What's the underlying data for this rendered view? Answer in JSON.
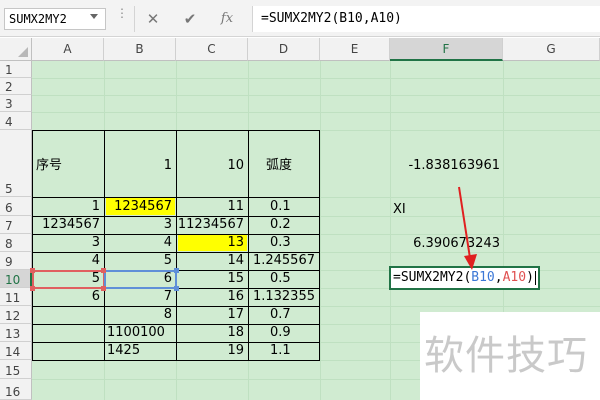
{
  "formula_bar": {
    "name_box": "SUMX2MY2",
    "cancel_icon": "✕",
    "enter_icon": "✔",
    "fx_label": "fx",
    "formula": "=SUMX2MY2(B10,A10)"
  },
  "columns": [
    "A",
    "B",
    "C",
    "D",
    "E",
    "F",
    "G"
  ],
  "selected_column": "F",
  "rows": [
    "1",
    "2",
    "3",
    "4",
    "5",
    "6",
    "7",
    "8",
    "9",
    "10",
    "11",
    "12",
    "13",
    "14",
    "15",
    "16"
  ],
  "selected_row": "10",
  "table": {
    "header": {
      "a": "序号",
      "b": "1",
      "c": "10",
      "d": "弧度"
    },
    "rows": [
      {
        "a": "1",
        "b": "1234567",
        "c": "11",
        "d": "0.1"
      },
      {
        "a": "1234567",
        "b": "3",
        "c": "11234567",
        "d": "0.2"
      },
      {
        "a": "3",
        "b": "4",
        "c": "13",
        "d": "0.3"
      },
      {
        "a": "4",
        "b": "5",
        "c": "14",
        "d": "1.245567"
      },
      {
        "a": "5",
        "b": "6",
        "c": "15",
        "d": "0.5"
      },
      {
        "a": "6",
        "b": "7",
        "c": "16",
        "d": "1.132355"
      },
      {
        "a": "",
        "b": "8",
        "c": "17",
        "d": "0.7"
      },
      {
        "a": "",
        "b": "1100100",
        "c": "18",
        "d": "0.9"
      },
      {
        "a": "",
        "b": "1425",
        "c": "19",
        "d": "1.1"
      }
    ]
  },
  "f_column": {
    "f5": "-1.838163961",
    "f6": "XI",
    "f8": "6.390673243"
  },
  "edit_cell": {
    "prefix": "=SUMX2MY2(",
    "ref1": "B10",
    "comma": ",",
    "ref2": "A10",
    "suffix": ")"
  },
  "watermark": "软件技巧",
  "colors": {
    "grid_green": "#d0ebd1",
    "highlight_yellow": "#ffff00",
    "ref_blue": "#3b77d6",
    "ref_red": "#e05050",
    "arrow_red": "#e02020",
    "selection_green": "#217346"
  }
}
